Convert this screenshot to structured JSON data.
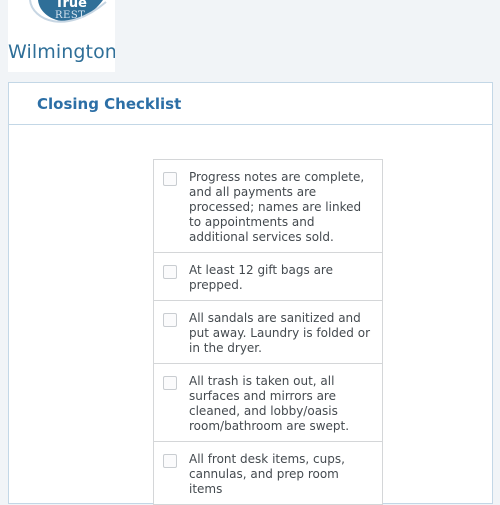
{
  "logo": {
    "brand_top": "True",
    "brand_bottom": "REST",
    "location": "Wilmington",
    "colors": {
      "swoosh": "#2f6f98",
      "text": "#2f6f98"
    }
  },
  "panel": {
    "title": "Closing Checklist"
  },
  "checklist": {
    "items": [
      {
        "label": "Progress notes are complete, and all payments are processed; names are linked to appointments and additional services sold.",
        "checked": false
      },
      {
        "label": "At least 12 gift bags are prepped.",
        "checked": false
      },
      {
        "label": "All sandals are sanitized and put away. Laundry is folded or in the dryer.",
        "checked": false
      },
      {
        "label": "All trash is taken out, all surfaces and mirrors are cleaned, and lobby/oasis room/bathroom are swept.",
        "checked": false
      },
      {
        "label": "All front desk items, cups, cannulas, and prep room items",
        "checked": false
      }
    ]
  },
  "colors": {
    "accent": "#2c6fa6",
    "border": "#c3d7e6",
    "background": "#f1f4f7"
  }
}
